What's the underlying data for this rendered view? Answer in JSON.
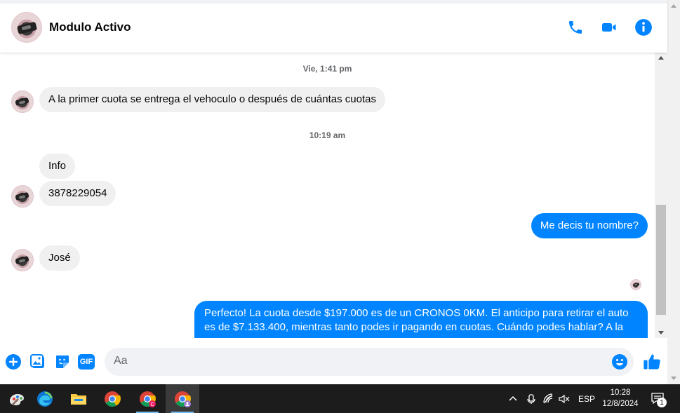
{
  "header": {
    "contact_name": "Modulo Activo",
    "call_icon": "phone-icon",
    "video_icon": "video-camera-icon",
    "info_icon": "info-icon",
    "accent_color": "#0084ff"
  },
  "messages": {
    "ts1": "Vie, 1:41 pm",
    "m1": "A la primer cuota se entrega el vehoculo o después de cuántas cuotas",
    "ts2": "10:19 am",
    "m2": "Info",
    "m3": "3878229054",
    "m4": "Me decis tu nombre?",
    "m5": "José",
    "m6_line1": "Perfecto! La cuota desde $197.000 es de un CRONOS 0KM. El anticipo para retirar el auto",
    "m6_line2": "es de $7.133.400, mientras tanto podes ir pagando en cuotas. Cuándo podes hablar? A la"
  },
  "composer": {
    "placeholder": "Aa",
    "add_icon": "plus-circle-icon",
    "image_icon": "image-icon",
    "sticker_icon": "sticker-icon",
    "gif_label": "GIF",
    "emoji_icon": "emoji-icon",
    "like_icon": "thumbs-up-icon"
  },
  "taskbar": {
    "apps": [
      "paint-icon",
      "edge-icon",
      "file-explorer-icon",
      "chrome-icon",
      "chrome-profile-c-icon",
      "chrome-profile-icon"
    ],
    "language": "ESP",
    "time": "10:28",
    "date": "12/8/2024",
    "notification_count": "1"
  }
}
